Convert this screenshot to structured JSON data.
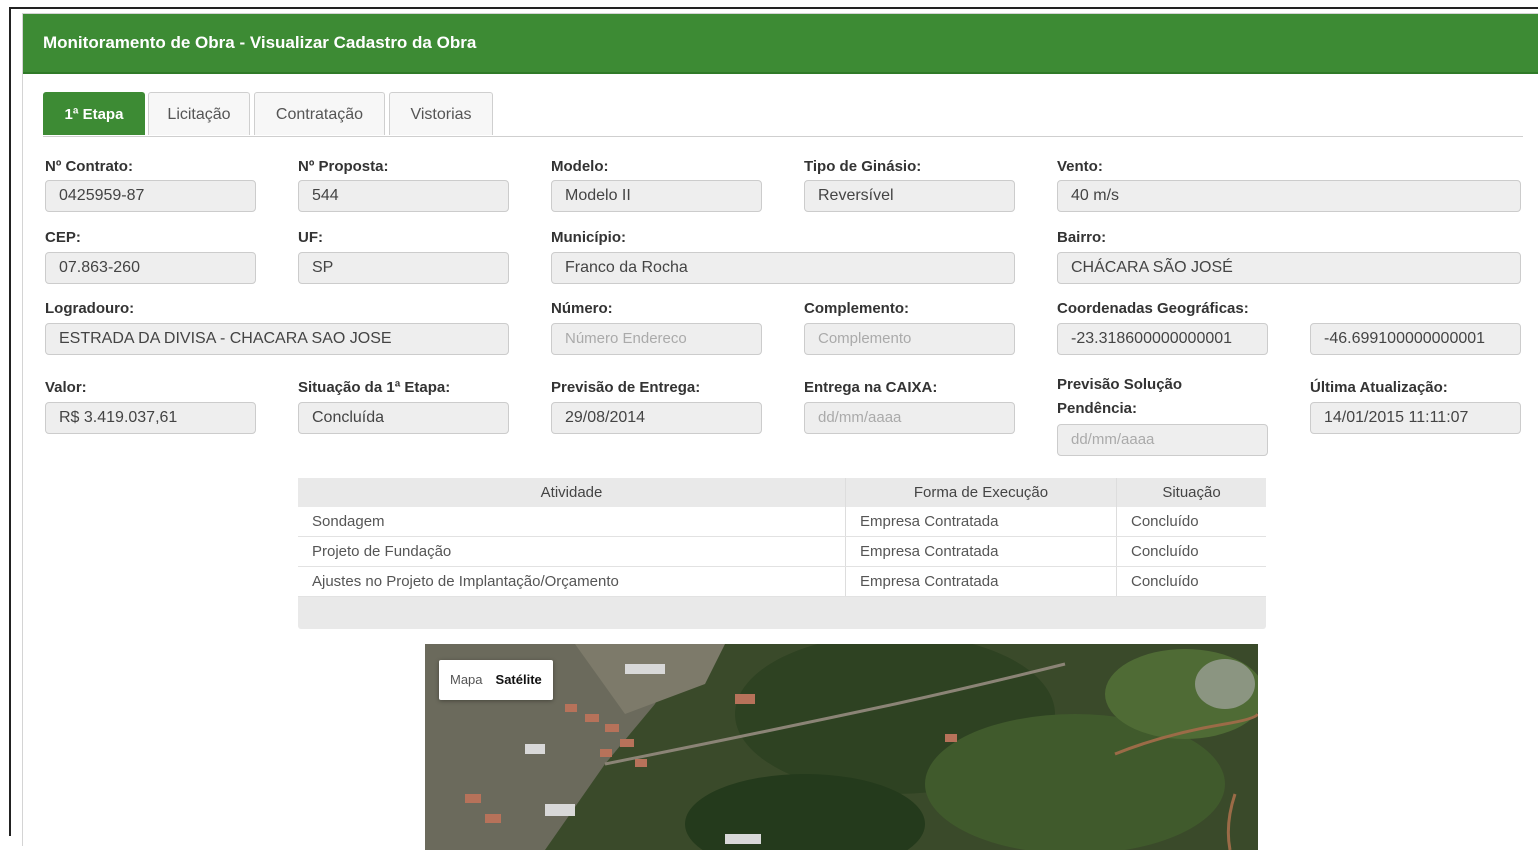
{
  "header": {
    "title": "Monitoramento de Obra - Visualizar Cadastro da Obra"
  },
  "tabs": [
    {
      "label": "1ª Etapa",
      "active": true
    },
    {
      "label": "Licitação"
    },
    {
      "label": "Contratação"
    },
    {
      "label": "Vistorias"
    }
  ],
  "fields": {
    "contrato": {
      "label": "Nº Contrato:",
      "value": "0425959-87"
    },
    "proposta": {
      "label": "Nº Proposta:",
      "value": "544"
    },
    "modelo": {
      "label": "Modelo:",
      "value": "Modelo II"
    },
    "ginasio": {
      "label": "Tipo de Ginásio:",
      "value": "Reversível"
    },
    "vento": {
      "label": "Vento:",
      "value": "40 m/s"
    },
    "cep": {
      "label": "CEP:",
      "value": "07.863-260"
    },
    "uf": {
      "label": "UF:",
      "value": "SP"
    },
    "municipio": {
      "label": "Município:",
      "value": "Franco da Rocha"
    },
    "bairro": {
      "label": "Bairro:",
      "value": "CHÁCARA SÃO JOSÉ"
    },
    "logradouro": {
      "label": "Logradouro:",
      "value": "ESTRADA DA DIVISA - CHACARA SAO JOSE"
    },
    "numero": {
      "label": "Número:",
      "placeholder": "Número Endereco"
    },
    "complemento": {
      "label": "Complemento:",
      "placeholder": "Complemento"
    },
    "coordenadas": {
      "label": "Coordenadas Geográficas:",
      "lat": "-23.318600000000001",
      "lng": "-46.699100000000001"
    },
    "valor": {
      "label": "Valor:",
      "value": "R$ 3.419.037,61"
    },
    "situacao": {
      "label": "Situação da 1ª Etapa:",
      "value": "Concluída"
    },
    "previsao_entrega": {
      "label": "Previsão de Entrega:",
      "value": "29/08/2014"
    },
    "entrega_caixa": {
      "label": "Entrega na CAIXA:",
      "placeholder": "dd/mm/aaaa"
    },
    "previsao_solucao": {
      "label_line1": "Previsão Solução",
      "label_line2": "Pendência:",
      "placeholder": "dd/mm/aaaa"
    },
    "ultima_atualizacao": {
      "label": "Última Atualização:",
      "value": "14/01/2015 11:11:07"
    }
  },
  "table": {
    "headers": [
      "Atividade",
      "Forma de Execução",
      "Situação"
    ],
    "rows": [
      [
        "Sondagem",
        "Empresa Contratada",
        "Concluído"
      ],
      [
        "Projeto de Fundação",
        "Empresa Contratada",
        "Concluído"
      ],
      [
        "Ajustes no Projeto de Implantação/Orçamento",
        "Empresa Contratada",
        "Concluído"
      ]
    ]
  },
  "map": {
    "btn_map": "Mapa",
    "btn_sat": "Satélite",
    "selected": "Satélite"
  }
}
